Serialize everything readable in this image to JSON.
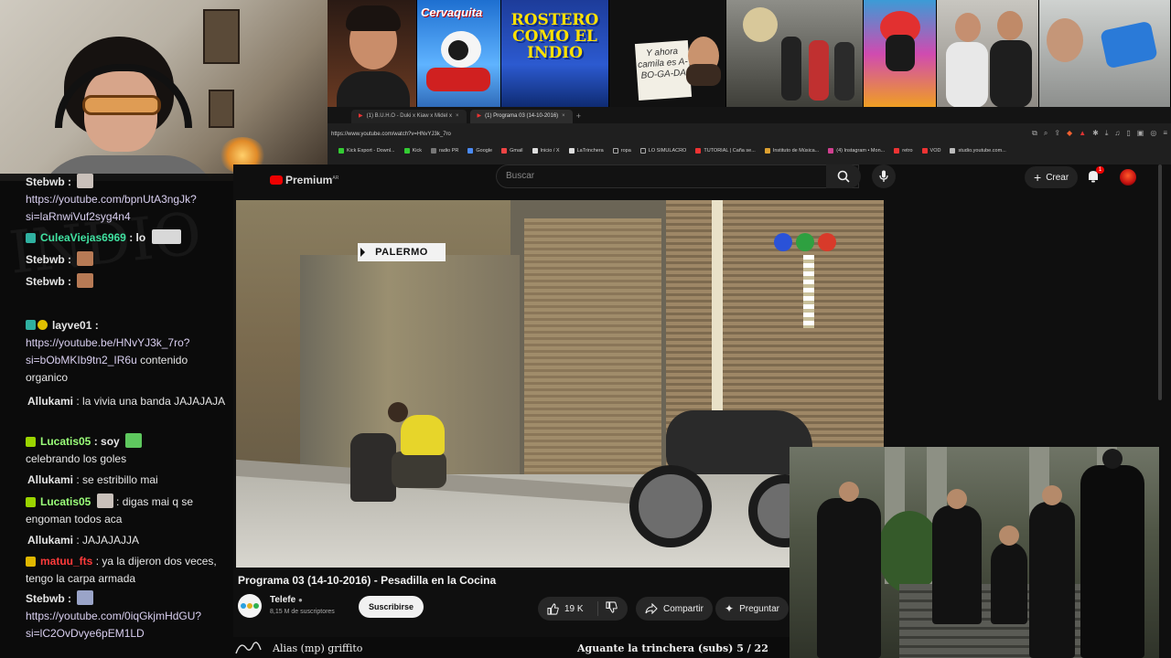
{
  "browser": {
    "tabs": [
      {
        "label": "(1) B.U.H.O - Duki x Kiaw x Midel x",
        "active": false
      },
      {
        "label": "(1) Programa 03 (14-10-2016)",
        "active": true
      }
    ],
    "url": "https://www.youtube.com/watch?v=HNvYJ3k_7ro",
    "bookmarks": [
      "Kick Export - Downl...",
      "Kick",
      "radio PR",
      "Google",
      "Gmail",
      "Inicio / X",
      "LaTrinchera",
      "ropa",
      "LO SIMULACRO",
      "TUTORIAL | Caña se...",
      "Instituto de Música...",
      "(4) Instagram • Mon...",
      "retro",
      "VOD",
      "studio.youtube.com..."
    ]
  },
  "strip": {
    "thumb_yellow_text": "ROSTERO COMO EL INDIO",
    "thumb_sub_text": "Cervaquita",
    "note_text": "Y ahora camila es A-BO-GA-DA"
  },
  "youtube": {
    "logo_label": "Premium",
    "logo_country": "AR",
    "search_placeholder": "Buscar",
    "create_label": "Crear",
    "notifications_count": "1",
    "video": {
      "overlay_label": "PALERMO",
      "title": "Programa 03 (14-10-2016) - Pesadilla en la Cocina",
      "channel": "Telefe",
      "subscribers": "8,15 M de suscriptores",
      "subscribe_label": "Suscribirse",
      "likes": "19 K",
      "share_label": "Compartir",
      "ask_label": "Preguntar"
    }
  },
  "chat": {
    "messages": [
      {
        "user": "Stebwb",
        "color": "#e6e6e6",
        "badge": "",
        "text": ":",
        "emote": "g",
        "link": "https://youtube.com/bpnUtA3ngJk?si=laRnwiVuf2syg4n4"
      },
      {
        "user": "CuleaViejas6969",
        "color": "#40e0a0",
        "badge": "#2fb0a0",
        "text": ": lo",
        "emote": "w",
        "link": ""
      },
      {
        "user": "Stebwb",
        "color": "#e6e6e6",
        "badge": "",
        "text": ":",
        "emote": "b",
        "link": ""
      },
      {
        "user": "Stebwb",
        "color": "#e6e6e6",
        "badge": "",
        "text": ":",
        "emote": "b",
        "link": ""
      },
      {
        "user": "layve01",
        "color": "#b8c8ff",
        "badge": "#2fb0a0",
        "text": ":",
        "emote": "",
        "link": "https://youtube.be/HNvYJ3k_7ro?si=bObMKIb9tn2_IR6u",
        "after": "contenido organico"
      },
      {
        "user": "Allukami",
        "color": "#e6e6e6",
        "badge": "",
        "text": ": la vivia una banda JAJAJAJA",
        "emote": "",
        "link": ""
      },
      {
        "user": "Lucatis05",
        "color": "#9bff7a",
        "badge": "#9bd400",
        "text": ": soy",
        "emote": "g",
        "link": "",
        "after": "celebrando los goles"
      },
      {
        "user": "Allukami",
        "color": "#e6e6e6",
        "badge": "",
        "text": ": se estribillo mai",
        "emote": "",
        "link": ""
      },
      {
        "user": "Lucatis05",
        "color": "#9bff7a",
        "badge": "#9bd400",
        "text": ": digas mai q se engoman todos aca",
        "emote": "",
        "link": ""
      },
      {
        "user": "Allukami",
        "color": "#e6e6e6",
        "badge": "",
        "text": ": JAJAJAJJA",
        "emote": "",
        "link": ""
      },
      {
        "user": "matuu_fts",
        "color": "#ff3b3b",
        "badge": "#e0b800",
        "text": ": ya la dijeron dos veces, tengo la carpa armada",
        "emote": "",
        "link": ""
      },
      {
        "user": "Stebwb",
        "color": "#e6e6e6",
        "badge": "",
        "text": ":",
        "emote": "g",
        "link": "https://youtube.com/0iqGkjmHdGU?si=lC2OvDvye6pEM1LD"
      }
    ]
  },
  "bottom": {
    "left_text": "Alias (mp) griffito",
    "right_text": "Aguante la trinchera (subs) 5 / 22"
  }
}
